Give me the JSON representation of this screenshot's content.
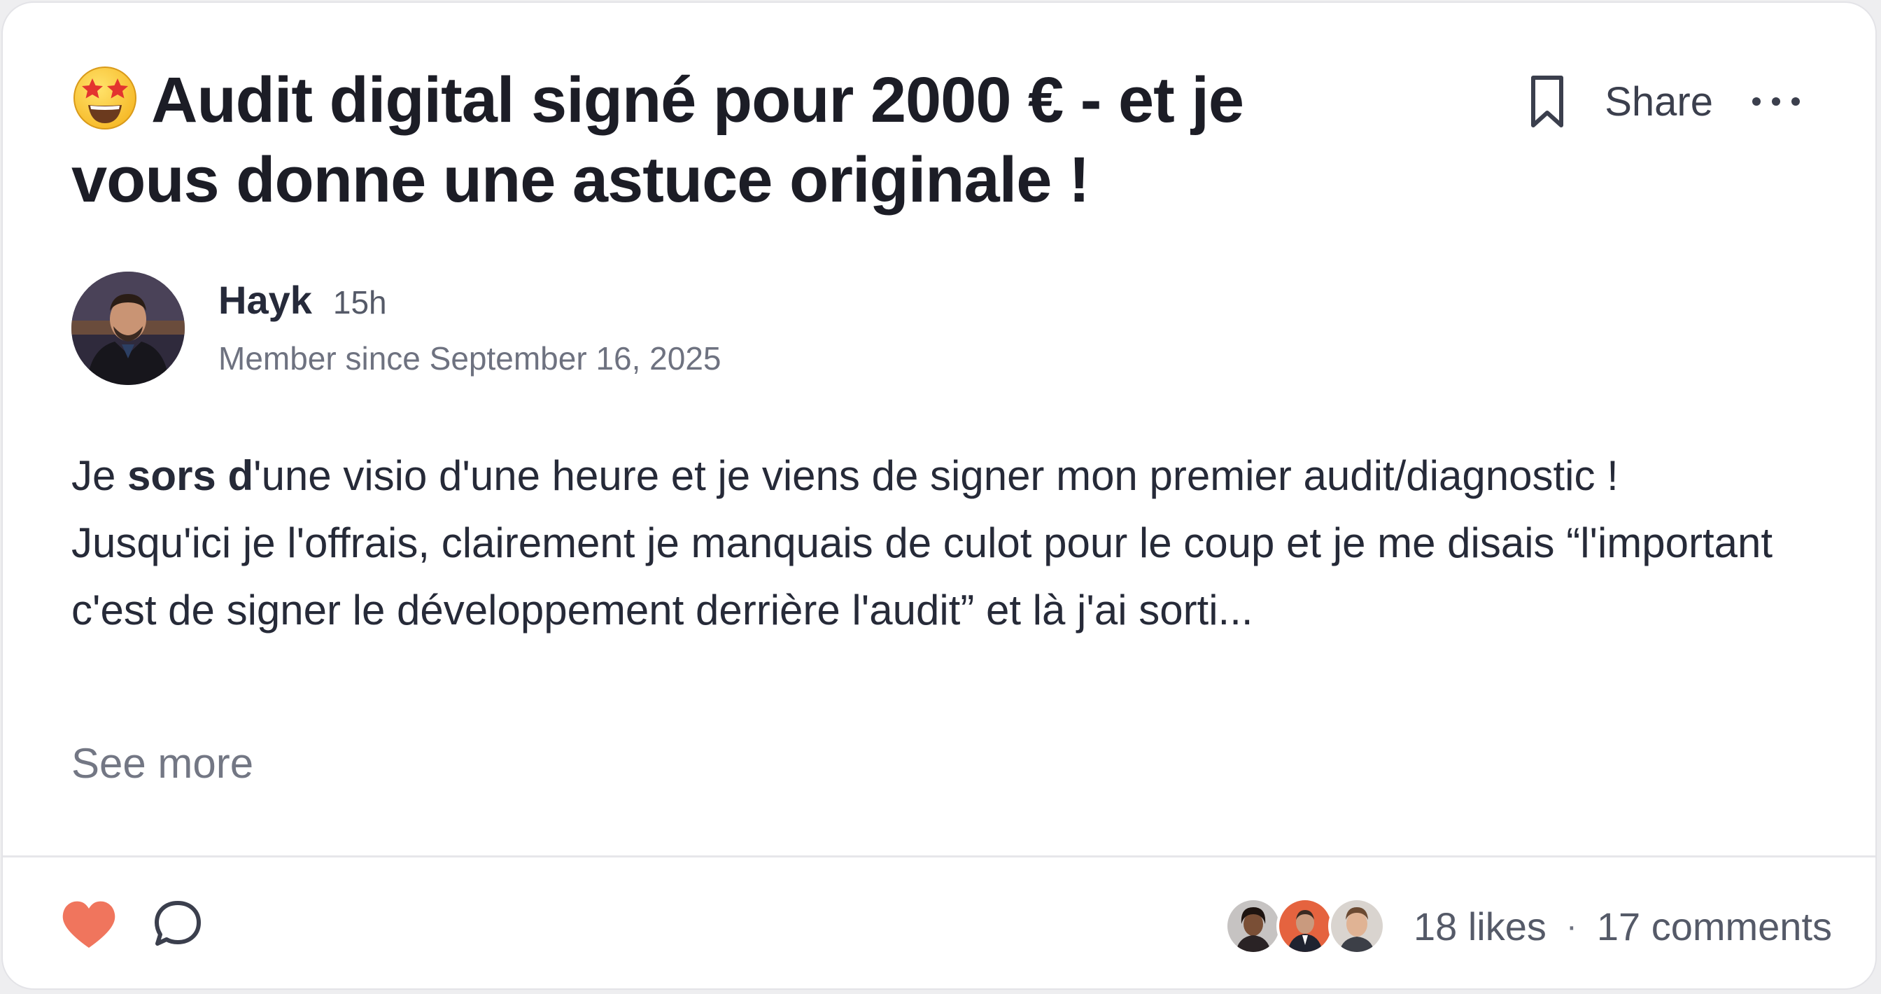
{
  "post": {
    "title_emoji": "star-struck-emoji",
    "title": "Audit digital signé pour 2000 € - et je vous donne une astuce originale !",
    "actions": {
      "bookmark_icon": "bookmark-icon",
      "share_label": "Share",
      "more_icon": "more-horizontal-icon"
    },
    "author": {
      "name": "Hayk",
      "time": "15h",
      "member_since": "Member since September 16, 2025"
    },
    "body": {
      "before_bold": "Je ",
      "bold": "sors d",
      "after_bold": "'une visio d'une heure et je viens de signer mon premier audit/diagnostic ! Jusqu'ici je l'offrais, clairement je manquais de culot pour le coup et je me disais “l'important c'est de signer le développement derrière l'audit” et là j'ai sorti..."
    },
    "see_more_label": "See more",
    "footer": {
      "like_icon": "heart-icon",
      "comment_icon": "comment-bubble-icon",
      "likes_label": "18 likes",
      "separator": "·",
      "comments_label": "17 comments"
    }
  },
  "colors": {
    "heart": "#f0755d",
    "text": "#1c1d26",
    "muted": "#6e7280"
  }
}
